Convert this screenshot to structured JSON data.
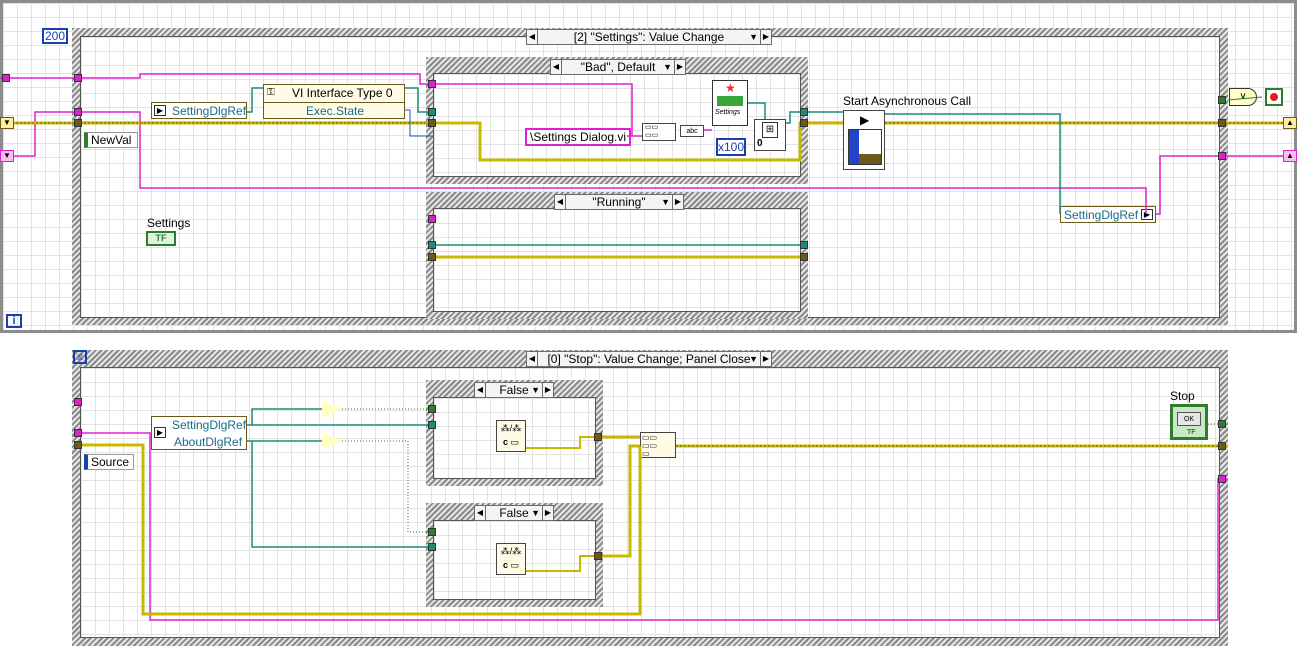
{
  "top_loop": {
    "timeout_constant": "200",
    "event_selector": "[2] \"Settings\": Value Change",
    "newval_label": "NewVal",
    "settings_label": "Settings",
    "settings_terminal": "TF",
    "case_bad": "\"Bad\", Default",
    "case_running": "\"Running\"",
    "setting_ref_label": "SettingDlgRef",
    "vi_interface_label": "VI Interface Type 0",
    "exec_state_label": "Exec.State",
    "path_constant": "\\Settings Dialog.vi",
    "x100_constant": "x100",
    "start_async_label": "Start Asynchronous Call",
    "settings_vi_icon_text": "Settings",
    "setting_ref_out_label": "SettingDlgRef",
    "iteration_icon": "i"
  },
  "bottom_loop": {
    "event_selector": "[0] \"Stop\": Value Change;  Panel Close",
    "source_label": "Source",
    "setting_ref_label": "SettingDlgRef",
    "about_ref_label": "AboutDlgRef",
    "case_false_1": "False",
    "case_false_2": "False",
    "stop_label": "Stop",
    "stop_button_text": "OK",
    "stop_terminal": "TF"
  },
  "colors": {
    "refnum_wire": "#1a8c7c",
    "error_wire": "#c9b800",
    "string_wire": "#e020d0",
    "frame_border": "#7a7a7a"
  }
}
